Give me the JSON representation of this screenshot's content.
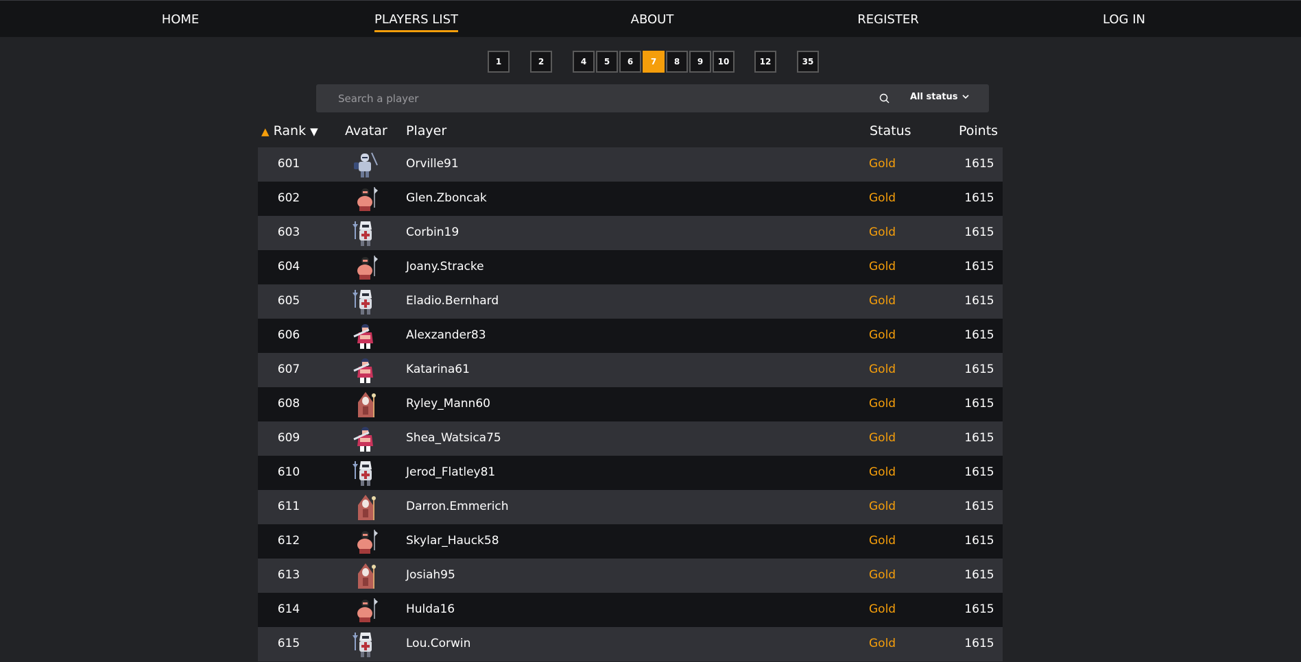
{
  "nav": {
    "home": "HOME",
    "players_list": "PLAYERS LIST",
    "about": "ABOUT",
    "register": "REGISTER",
    "login": "LOG IN"
  },
  "pagination": {
    "pages": [
      "1",
      "2",
      "4",
      "5",
      "6",
      "7",
      "8",
      "9",
      "10",
      "12",
      "35"
    ],
    "current": "7"
  },
  "search": {
    "placeholder": "Search a player",
    "status_filter": "All status"
  },
  "table": {
    "headers": {
      "rank": "Rank",
      "avatar": "Avatar",
      "player": "Player",
      "status": "Status",
      "points": "Points"
    },
    "rows": [
      {
        "rank": "601",
        "avatar": "knight",
        "player": "Orville91",
        "status": "Gold",
        "points": "1615"
      },
      {
        "rank": "602",
        "avatar": "barbarian",
        "player": "Glen.Zboncak",
        "status": "Gold",
        "points": "1615"
      },
      {
        "rank": "603",
        "avatar": "paladin",
        "player": "Corbin19",
        "status": "Gold",
        "points": "1615"
      },
      {
        "rank": "604",
        "avatar": "barbarian",
        "player": "Joany.Stracke",
        "status": "Gold",
        "points": "1615"
      },
      {
        "rank": "605",
        "avatar": "paladin",
        "player": "Eladio.Bernhard",
        "status": "Gold",
        "points": "1615"
      },
      {
        "rank": "606",
        "avatar": "swordsman",
        "player": "Alexzander83",
        "status": "Gold",
        "points": "1615"
      },
      {
        "rank": "607",
        "avatar": "swordsman",
        "player": "Katarina61",
        "status": "Gold",
        "points": "1615"
      },
      {
        "rank": "608",
        "avatar": "mage",
        "player": "Ryley_Mann60",
        "status": "Gold",
        "points": "1615"
      },
      {
        "rank": "609",
        "avatar": "swordsman",
        "player": "Shea_Watsica75",
        "status": "Gold",
        "points": "1615"
      },
      {
        "rank": "610",
        "avatar": "paladin",
        "player": "Jerod_Flatley81",
        "status": "Gold",
        "points": "1615"
      },
      {
        "rank": "611",
        "avatar": "mage",
        "player": "Darron.Emmerich",
        "status": "Gold",
        "points": "1615"
      },
      {
        "rank": "612",
        "avatar": "barbarian",
        "player": "Skylar_Hauck58",
        "status": "Gold",
        "points": "1615"
      },
      {
        "rank": "613",
        "avatar": "mage",
        "player": "Josiah95",
        "status": "Gold",
        "points": "1615"
      },
      {
        "rank": "614",
        "avatar": "barbarian",
        "player": "Hulda16",
        "status": "Gold",
        "points": "1615"
      },
      {
        "rank": "615",
        "avatar": "paladin",
        "player": "Lou.Corwin",
        "status": "Gold",
        "points": "1615"
      }
    ]
  },
  "colors": {
    "accent": "#f59e0b",
    "page_bg": "#222326",
    "nav_bg": "#131416",
    "row_light": "#313237",
    "row_dark": "#131417"
  }
}
